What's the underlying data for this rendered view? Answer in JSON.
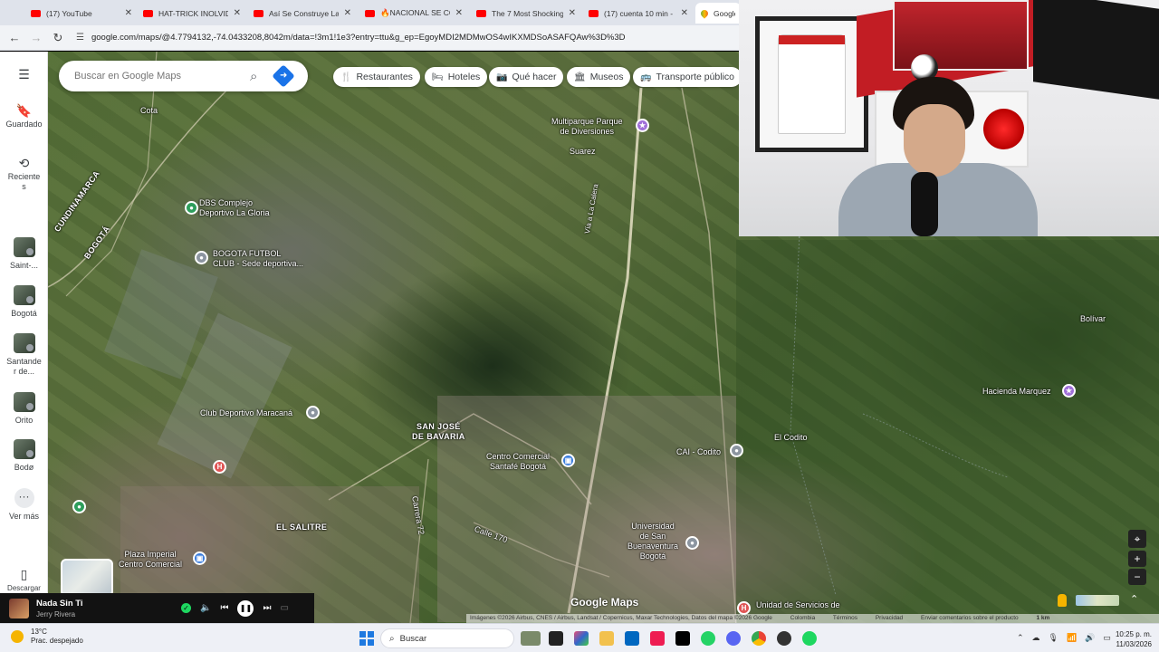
{
  "browser": {
    "tabs": [
      {
        "title": "(17) YouTube",
        "icon": "youtube-icon"
      },
      {
        "title": "HAT-TRICK INOLVIDA",
        "icon": "youtube-icon"
      },
      {
        "title": "Así Se Construye La M",
        "icon": "youtube-icon"
      },
      {
        "title": "🔥NACIONAL SE CO",
        "icon": "youtube-icon"
      },
      {
        "title": "The 7 Most Shocking",
        "icon": "youtube-icon"
      },
      {
        "title": "(17) cuenta 10 min -",
        "icon": "youtube-icon"
      },
      {
        "title": "Google",
        "icon": "google-maps-icon"
      }
    ],
    "url": "google.com/maps/@4.7794132,-74.0433208,8042m/data=!3m1!1e3?entry=ttu&g_ep=EgoyMDI2MDMwOS4wIKXMDSoASAFQAw%3D%3D"
  },
  "rail": {
    "items": [
      {
        "label": "Guardado",
        "icon": "bookmark-icon"
      },
      {
        "label": "Reciente\ns",
        "icon": "history-icon"
      },
      {
        "label": "Saint-...",
        "icon": "place-thumbnail"
      },
      {
        "label": "Bogotá",
        "icon": "place-thumbnail"
      },
      {
        "label": "Santande\nr de...",
        "icon": "place-thumbnail"
      },
      {
        "label": "Orito",
        "icon": "place-thumbnail"
      },
      {
        "label": "Bodø",
        "icon": "place-thumbnail"
      },
      {
        "label": "Ver más",
        "icon": "more-icon"
      }
    ],
    "bottom_label": "Descargar"
  },
  "search": {
    "placeholder": "Buscar en Google Maps"
  },
  "chips": [
    {
      "label": "Restaurantes",
      "icon": "🍴"
    },
    {
      "label": "Hoteles",
      "icon": "🛏"
    },
    {
      "label": "Qué hacer",
      "icon": "📷"
    },
    {
      "label": "Museos",
      "icon": "🏛"
    },
    {
      "label": "Transporte público",
      "icon": "🚌"
    }
  ],
  "map_labels": {
    "cota": "Cota",
    "multiparque": "Multiparque Parque\nde Diversiones",
    "suarez": "Suarez",
    "dbs": "DBS Complejo\nDeportivo La Gloria",
    "cundinamarca": "CUNDINAMARCA",
    "bogota_side": "BOGOTÁ",
    "bogota_futbol": "BOGOTA FUTBOL\nCLUB - Sede deportiva...",
    "bolivar": "Bolívar",
    "hacienda": "Hacienda Marquez",
    "club_maracana": "Club Deportivo Maracaná",
    "san_jose": "SAN JOSÉ\nDE BAVARIA",
    "el_codito": "El Codito",
    "cali_codito": "CAI - Codito",
    "centro_santafe": "Centro Comercial\nSantafé Bogotá",
    "el_salitre": "EL SALITRE",
    "calle170": "Calle 170",
    "carrera72": "Carrera 72",
    "universidad": "Universidad\nde San\nBuenaventura\nBogotá",
    "plaza_imperial": "Plaza Imperial\nCentro Comercial",
    "unidad_servicios": "Unidad de Servicios de",
    "la_calera": "Vía a La Calera"
  },
  "attribution": [
    "Imágenes ©2026 Airbus, CNES / Airbus, Landsat / Copernicus, Maxar Technologies, Datos del mapa ©2026 Google",
    "Colombia",
    "Términos",
    "Privacidad",
    "Enviar comentarios sobre el producto",
    "1 km"
  ],
  "google_logo": "Google Maps",
  "player": {
    "song": "Nada Sin Ti",
    "artist": "Jerry Rivera"
  },
  "taskbar": {
    "weather_temp": "13°C",
    "weather_desc": "Prac. despejado",
    "search_label": "Buscar",
    "time": "10:25 p. m.",
    "date": "11/03/2026"
  },
  "colors": {
    "accent": "#1a73e8",
    "youtube": "#ff0000",
    "spotify": "#1ed760"
  }
}
